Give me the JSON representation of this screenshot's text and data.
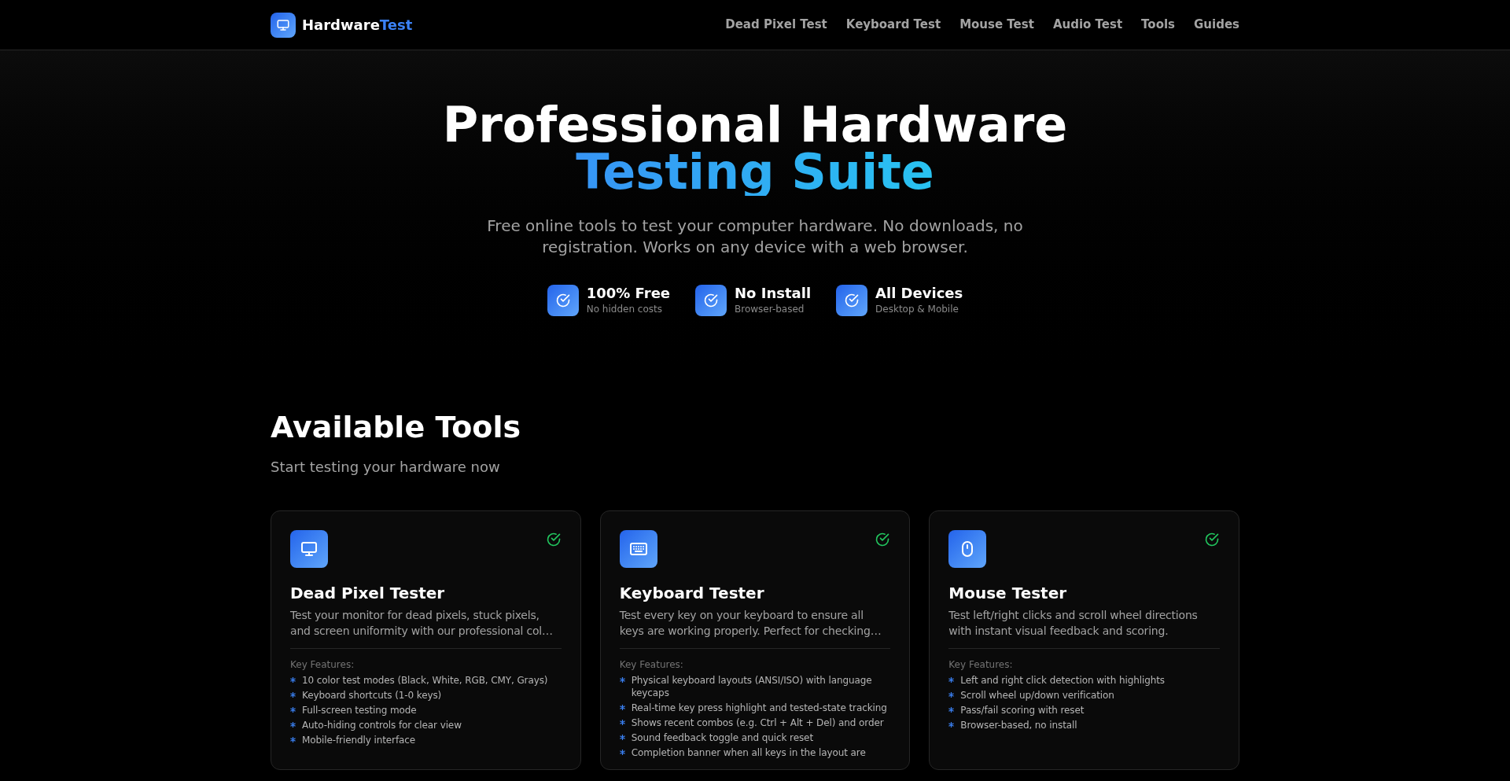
{
  "header": {
    "logo": [
      "Hardware",
      "Test"
    ],
    "nav": [
      "Dead Pixel Test",
      "Keyboard Test",
      "Mouse Test",
      "Audio Test",
      "Tools",
      "Guides"
    ]
  },
  "hero": {
    "title": "Professional Hardware",
    "title_highlight": "Testing Suite",
    "subtitle": "Free online tools to test your computer hardware. No downloads, no registration. Works on any device with a web browser.",
    "badges": [
      {
        "title": "100% Free",
        "caption": "No hidden costs"
      },
      {
        "title": "No Install",
        "caption": "Browser-based"
      },
      {
        "title": "All Devices",
        "caption": "Desktop & Mobile"
      }
    ]
  },
  "tools": {
    "heading": "Available Tools",
    "subheading": "Start testing your hardware now",
    "cards": [
      {
        "kind": "monitor",
        "title": "Dead Pixel Tester",
        "description": "Test your monitor for dead pixels, stuck pixels, and screen uniformity with our professional col…",
        "features_label": "Key Features:",
        "features": [
          "10 color test modes (Black, White, RGB, CMY, Grays)",
          "Keyboard shortcuts (1-0 keys)",
          "Full-screen testing mode",
          "Auto-hiding controls for clear view",
          "Mobile-friendly interface"
        ]
      },
      {
        "kind": "keyboard",
        "title": "Keyboard Tester",
        "description": "Test every key on your keyboard to ensure all keys are working properly. Perfect for checking…",
        "features_label": "Key Features:",
        "features": [
          "Physical keyboard layouts (ANSI/ISO) with language keycaps",
          "Real-time key press highlight and tested-state tracking",
          "Shows recent combos (e.g. Ctrl + Alt + Del) and order",
          "Sound feedback toggle and quick reset",
          "Completion banner when all keys in the layout are"
        ]
      },
      {
        "kind": "mouse",
        "title": "Mouse Tester",
        "description": "Test left/right clicks and scroll wheel directions with instant visual feedback and scoring.",
        "features_label": "Key Features:",
        "features": [
          "Left and right click detection with highlights",
          "Scroll wheel up/down verification",
          "Pass/fail scoring with reset",
          "Browser-based, no install"
        ]
      }
    ]
  }
}
